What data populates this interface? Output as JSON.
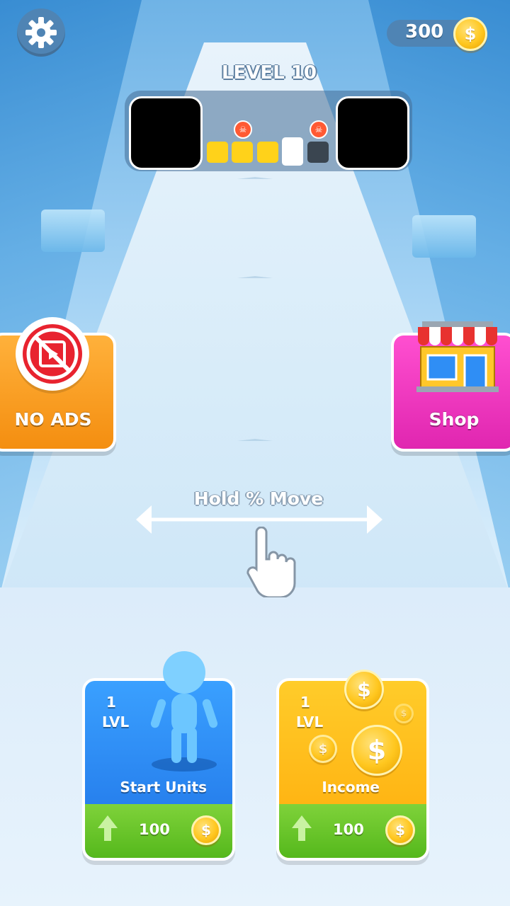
{
  "hud": {
    "coin_balance": "300",
    "level_title": "LEVEL 10"
  },
  "progress": {
    "stages": [
      "completed",
      "completed",
      "completed",
      "current",
      "locked"
    ],
    "skull_markers": 2
  },
  "side_buttons": {
    "no_ads_label": "NO ADS",
    "shop_label": "Shop"
  },
  "hint": {
    "text": "Hold % Move"
  },
  "cards": [
    {
      "level": "1",
      "level_word": "LVL",
      "name": "Start Units",
      "price": "100"
    },
    {
      "level": "1",
      "level_word": "LVL",
      "name": "Income",
      "price": "100"
    }
  ],
  "icons": {
    "settings": "gear-icon",
    "currency": "dollar-coin-icon",
    "no_ads": "no-video-icon",
    "shop": "storefront-icon",
    "upgrade": "arrow-up-icon",
    "hint": "pointing-hand-icon"
  },
  "colors": {
    "completed_stage": "#ffd21a",
    "current_stage": "#ffffff",
    "locked_stage": "#3a4550",
    "no_ads_bg": "#f59a1c",
    "shop_bg": "#ec33c0",
    "card_blue": "#2f8ef5",
    "card_yellow": "#ffbe1a",
    "upgrade_green": "#6cc82c"
  }
}
